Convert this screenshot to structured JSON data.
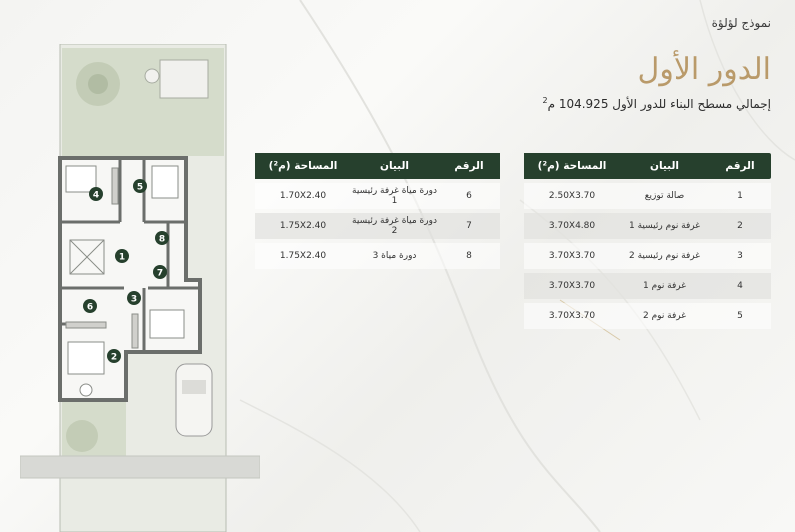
{
  "header": {
    "brand": "نموذج لؤلؤة",
    "title": "الدور الأول",
    "subtitle": "إجمالي مسطح البناء للدور الأول 104.925 م",
    "subtitle_sup": "2"
  },
  "table_right": {
    "headers": [
      "الرقم",
      "البيان",
      "المساحة (م²)"
    ],
    "rows": [
      [
        "1",
        "صالة توزيع",
        "2.50X3.70"
      ],
      [
        "2",
        "غرفة نوم رئيسية 1",
        "3.70X4.80"
      ],
      [
        "3",
        "غرفة نوم رئيسية 2",
        "3.70X3.70"
      ],
      [
        "4",
        "غرفة نوم 1",
        "3.70X3.70"
      ],
      [
        "5",
        "غرفة نوم 2",
        "3.70X3.70"
      ]
    ]
  },
  "table_left": {
    "headers": [
      "الرقم",
      "البيان",
      "المساحة (م²)"
    ],
    "rows": [
      [
        "6",
        "دورة مياة غرفة رئيسية 1",
        "1.70X2.40"
      ],
      [
        "7",
        "دورة مياة غرفة رئيسية 2",
        "1.75X2.40"
      ],
      [
        "8",
        "دورة مياة 3",
        "1.75X2.40"
      ]
    ]
  },
  "plan": {
    "markers": [
      "1",
      "2",
      "3",
      "4",
      "5",
      "6",
      "7",
      "8"
    ],
    "colors": {
      "marker": "#26402d",
      "wall": "#6b6e6b",
      "garden": "#d5dccb"
    }
  }
}
